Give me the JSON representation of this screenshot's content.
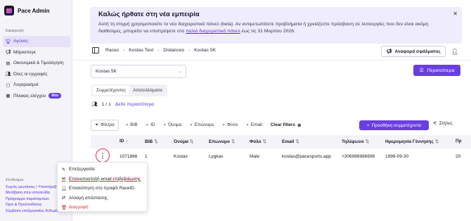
{
  "app": {
    "name": "Pace Admin"
  },
  "sidebar": {
    "section_label": "Εφαρμογή",
    "items": [
      {
        "label": "Αγώνες",
        "icon": "trophy-icon",
        "active": true
      },
      {
        "label": "Μάρκετινγκ",
        "icon": "megaphone-icon"
      },
      {
        "label": "Οικονομικά & Τιμολόγηση",
        "icon": "finance-icon"
      },
      {
        "label": "Όλες οι εγγραφές",
        "icon": "users-icon"
      },
      {
        "label": "Λογαριασμοί",
        "icon": "accounts-icon"
      },
      {
        "label": "Πίνακας ελέγχου",
        "icon": "dashboard-icon",
        "badge": "Νέο"
      }
    ],
    "footer_title": "Σύνδεσμοι",
    "footer_links": [
      "Συχνές ερωτήσεις / Υποστήριξη",
      "Μετάβαση στην ιστοσελίδα",
      "Πρόγραμμα παραπομπών",
      "Όροι & Προϋποθέσεις",
      "Σύμβαση επεξεργασίας δεδομένων"
    ]
  },
  "banner": {
    "title": "Καλώς ήρθατε στη νέα εμπειρία",
    "text_before": "Αυτή τη στιγμή χρησιμοποιείτε το νέο διαχειριστικό πάνελ (beta). Αν αντιμετωπίσετε προβλήματα ή χρειάζεστε πρόσβαση σε λειτουργίες που δεν είναι ακόμη διαθέσιμες, μπορείτε να επιστρέψετε στο ",
    "link_text": "παλιό διαχειριστικό πάνελ",
    "text_after": " έως τις 31 Μαρτίου 2026.",
    "close": "✕"
  },
  "breadcrumb": [
    "Races",
    "Kostas Test",
    "Distances",
    "Kostas 5K"
  ],
  "header": {
    "report_button": "Αναφορά σφάλματος",
    "more_button": "Περισσότερα"
  },
  "race_select": {
    "value": "Kostas 5K"
  },
  "tabs": [
    {
      "label": "Συμμετέχοντες",
      "selected": true
    },
    {
      "label": "Αποτελέσματα",
      "selected": false
    }
  ],
  "participants": {
    "count": "1 / 1",
    "see_more": "Δείτε περισσότερα"
  },
  "filters": {
    "filter_label": "Φίλτρα",
    "fields": [
      "BIB",
      "ID",
      "Όνομα",
      "Επώνυμο",
      "Φύλο",
      "Email"
    ],
    "clear": "Clear filters",
    "add_button": "Προσθήκη συμμετέχοντα",
    "columns_button": "Στήλες"
  },
  "table": {
    "columns": [
      "ID",
      "BIB",
      "Όνομα",
      "Επώνυμο",
      "Φύλο",
      "Email",
      "Τηλέφωνο",
      "Ημερομηνία Γέννησης",
      "Πρ"
    ],
    "rows": [
      [
        "1071866",
        "1",
        "Kostas",
        "Lygkas",
        "Male",
        "kostas@pacesports.app",
        "+306986986698",
        "1996-09-30",
        "20"
      ]
    ]
  },
  "row_menu": [
    {
      "label": "Επεξεργασία",
      "icon": "edit-icon"
    },
    {
      "label": "Επαναποστολή email επιβεβαίωσης",
      "icon": "mail-icon"
    },
    {
      "label": "Επισκόπηση στο προφίλ RaceID",
      "icon": "profile-icon"
    },
    {
      "label": "Αλλαγή απόστασης",
      "icon": "swap-icon"
    },
    {
      "label": "Διαγραφή",
      "icon": "trash-icon"
    }
  ],
  "colors": {
    "accent": "#6a3fe0",
    "danger": "#e0303a",
    "banner_bg": "#efecfb"
  }
}
